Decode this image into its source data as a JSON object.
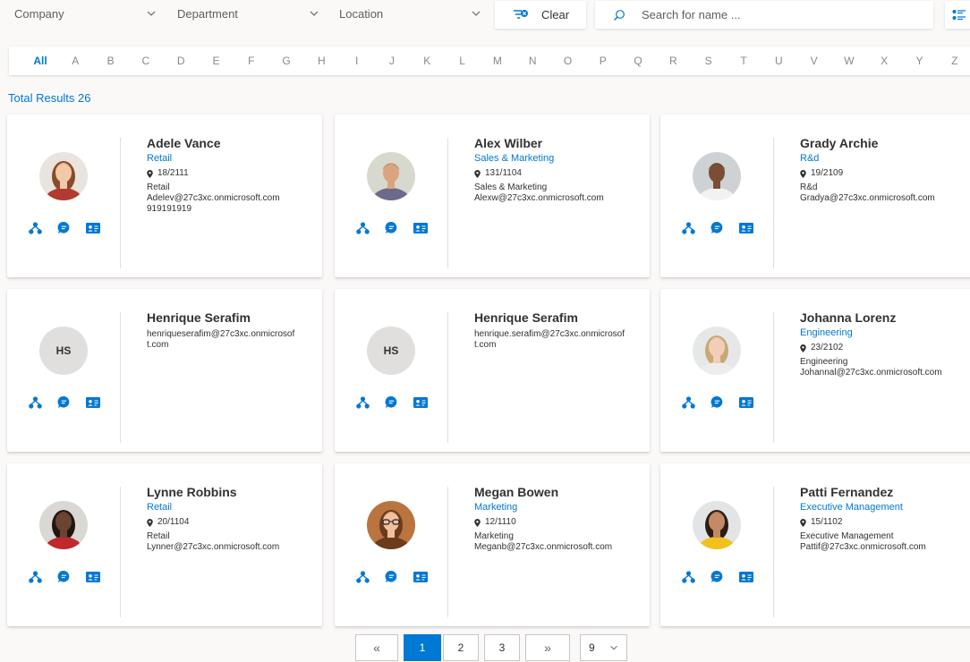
{
  "filters": {
    "company_label": "Company",
    "department_label": "Department",
    "location_label": "Location",
    "clear_label": "Clear",
    "search_placeholder": "Search for name ..."
  },
  "alphabet": [
    "All",
    "A",
    "B",
    "C",
    "D",
    "E",
    "F",
    "G",
    "H",
    "I",
    "J",
    "K",
    "L",
    "M",
    "N",
    "O",
    "P",
    "Q",
    "R",
    "S",
    "T",
    "U",
    "V",
    "W",
    "X",
    "Y",
    "Z"
  ],
  "active_letter": "All",
  "total_results": "Total Results 26",
  "accent_color": "#0078d4",
  "cards": [
    {
      "name": "Adele Vance",
      "department": "Retail",
      "location": "18/2111",
      "details": "Retail\nAdelev@27c3xc.onmicrosoft.com\n919191919",
      "avatar": "photo-woman-red-hair"
    },
    {
      "name": "Alex Wilber",
      "department": "Sales & Marketing",
      "location": "131/1104",
      "details": "Sales & Marketing\nAlexw@27c3xc.onmicrosoft.com",
      "avatar": "photo-man-tie"
    },
    {
      "name": "Grady Archie",
      "department": "R&d",
      "location": "19/2109",
      "details": "R&d\nGradya@27c3xc.onmicrosoft.com",
      "avatar": "photo-man-dark"
    },
    {
      "name": "Henrique Serafim",
      "department": "",
      "location": "",
      "details": "henriqueserafim@27c3xc.onmicrosoft.com",
      "avatar": "initials",
      "initials": "HS"
    },
    {
      "name": "Henrique Serafim",
      "department": "",
      "location": "",
      "details": "henrique.serafim@27c3xc.onmicrosoft.com",
      "avatar": "initials",
      "initials": "HS"
    },
    {
      "name": "Johanna Lorenz",
      "department": "Engineering",
      "location": "23/2102",
      "details": "Engineering\nJohannal@27c3xc.onmicrosoft.com",
      "avatar": "photo-woman-blonde"
    },
    {
      "name": "Lynne Robbins",
      "department": "Retail",
      "location": "20/1104",
      "details": "Retail\nLynner@27c3xc.onmicrosoft.com",
      "avatar": "photo-woman-red-jacket"
    },
    {
      "name": "Megan Bowen",
      "department": "Marketing",
      "location": "12/1110",
      "details": "Marketing\nMeganb@27c3xc.onmicrosoft.com",
      "avatar": "photo-woman-glasses"
    },
    {
      "name": "Patti Fernandez",
      "department": "Executive Management",
      "location": "15/1102",
      "details": "Executive Management\nPattif@27c3xc.onmicrosoft.com",
      "avatar": "photo-woman-yellow"
    }
  ],
  "card_actions": [
    "org-chart-icon",
    "chat-icon",
    "contact-card-icon"
  ],
  "pagination": {
    "first": "«",
    "pages": [
      "1",
      "2",
      "3"
    ],
    "active_page": "1",
    "last": "»",
    "page_size": "9"
  }
}
